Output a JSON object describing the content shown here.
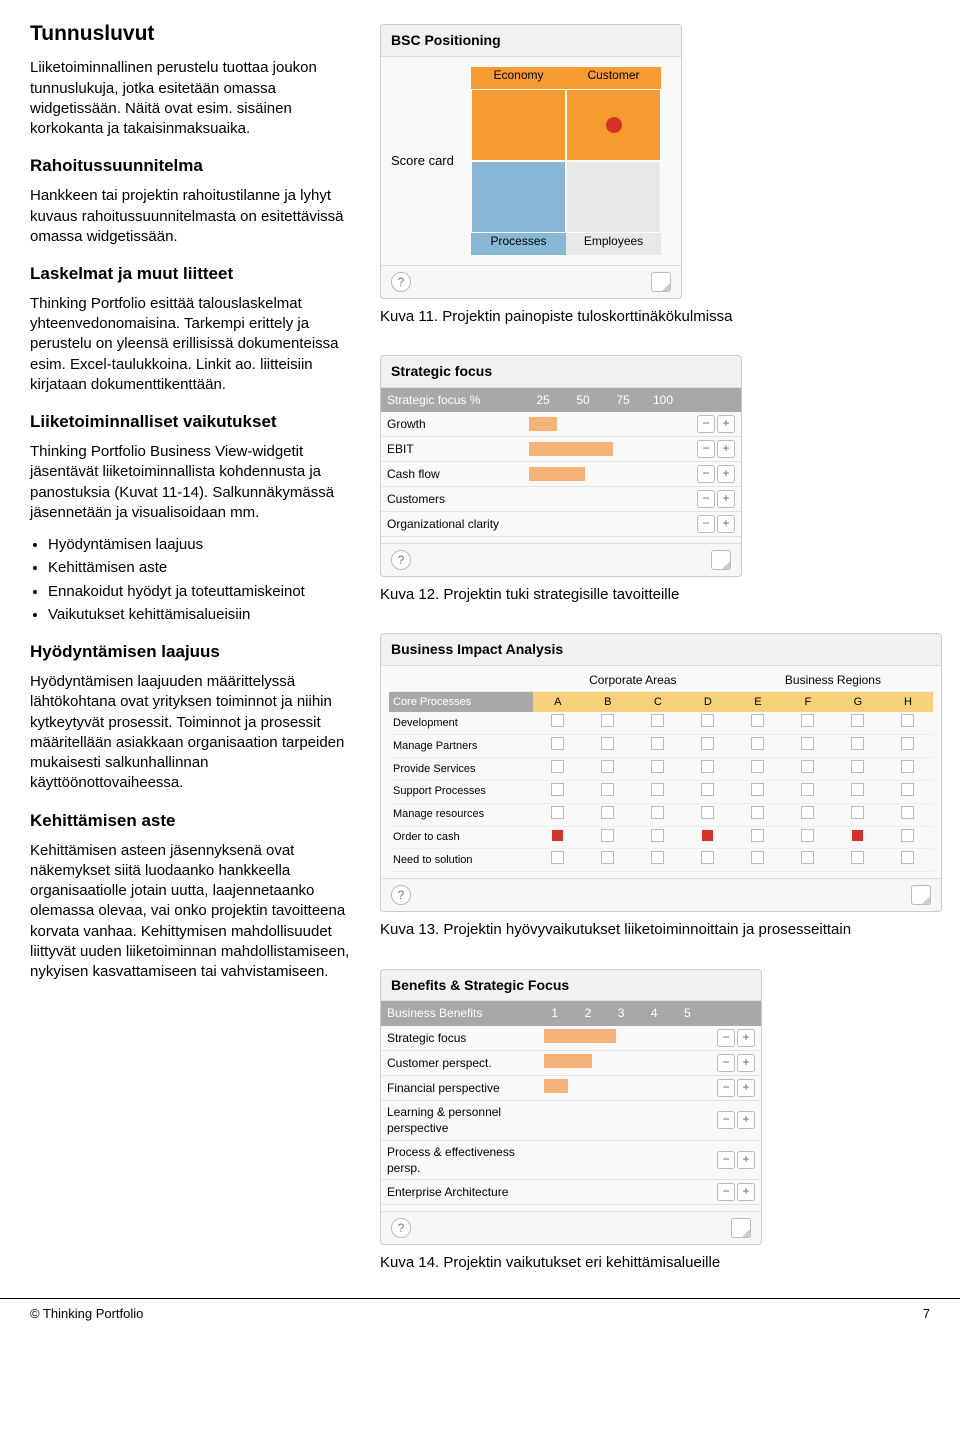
{
  "left": {
    "h1": "Tunnusluvut",
    "p1": "Liiketoiminnallinen perustelu tuottaa joukon tunnuslukuja, jotka esitetään omassa widgetissään. Näitä ovat esim. sisäinen korkokanta ja takaisin­maksuaika.",
    "h2a": "Rahoitussuunnitelma",
    "p2": "Hankkeen tai projektin rahoitustilanne ja lyhyt kuvaus rahoitussuunnitelmasta on esitettävissä omassa widgetissään.",
    "h2b": "Laskelmat ja muut liitteet",
    "p3": "Thinking Portfolio esittää talouslaskelmat yhteenvedonomaisina. Tarkempi erittely ja perustelu on yleensä erillisissä dokumenteissa esim. Excel-taulukkoina. Linkit ao. liitteisiin kirjataan dokumenttikenttään.",
    "h2c": "Liiketoiminnalliset vaikutukset",
    "p4": "Thinking Portfolio Business View-widgetit jäsentävät liiketoiminnallista kohdennusta ja panostuksia (Kuvat 11-14). Salkunnäkymässä jäsennetään ja visualisoidaan mm.",
    "bullets": [
      "Hyödyntämisen laajuus",
      "Kehittämisen aste",
      "Ennakoidut hyödyt ja toteuttamiskeinot",
      "Vaikutukset kehittämisalueisiin"
    ],
    "h2d": "Hyödyntämisen laajuus",
    "p5": "Hyödyntämisen laajuuden määrittelyssä lähtökohtana ovat yrityksen toiminnot ja niihin kytkeytyvät prosessit. Toiminnot ja prosessit määritellään asiakkaan organisaation tarpeiden mukaisesti salkunhallinnan käyttöönottovaiheessa.",
    "h2e": "Kehittämisen aste",
    "p6": "Kehittämisen asteen jäsennyksenä ovat näkemykset siitä luodaanko hankkeella organisaatiolle jotain uutta, laajennetaanko olemassa olevaa, vai onko projektin tavoitteena korvata vanhaa. Kehittymisen mahdollisuudet liittyvät uuden liiketoiminnan mahdollistamiseen, nykyisen kasvattamiseen tai vahvistamiseen."
  },
  "bsc": {
    "title": "BSC Positioning",
    "ylabel": "Score card",
    "top_left": "Economy",
    "top_right": "Customer",
    "bottom_left": "Processes",
    "bottom_right": "Employees"
  },
  "cap11": "Kuva 11. Projektin painopiste tuloskorttinäkökulmissa",
  "sf": {
    "title": "Strategic focus",
    "header": "Strategic focus %",
    "ticks": [
      "25",
      "50",
      "75",
      "100"
    ],
    "rows": [
      {
        "label": "Growth",
        "val": 1
      },
      {
        "label": "EBIT",
        "val": 3
      },
      {
        "label": "Cash flow",
        "val": 2
      },
      {
        "label": "Customers",
        "val": 0
      },
      {
        "label": "Organizational clarity",
        "val": 0
      }
    ]
  },
  "cap12": "Kuva 12. Projektin tuki strategisille tavoitteille",
  "bia": {
    "title": "Business Impact Analysis",
    "group1": "Corporate Areas",
    "group2": "Business Regions",
    "rowhead": "Core Processes",
    "cols": [
      "A",
      "B",
      "C",
      "D",
      "E",
      "F",
      "G",
      "H"
    ],
    "rows": [
      {
        "label": "Development",
        "cells": [
          0,
          0,
          0,
          0,
          0,
          0,
          0,
          0
        ]
      },
      {
        "label": "Manage Partners",
        "cells": [
          0,
          0,
          0,
          0,
          0,
          0,
          0,
          0
        ]
      },
      {
        "label": "Provide Services",
        "cells": [
          0,
          0,
          0,
          0,
          0,
          0,
          0,
          0
        ]
      },
      {
        "label": "Support Processes",
        "cells": [
          0,
          0,
          0,
          0,
          0,
          0,
          0,
          0
        ]
      },
      {
        "label": "Manage resources",
        "cells": [
          0,
          0,
          0,
          0,
          0,
          0,
          0,
          0
        ]
      },
      {
        "label": "Order to cash",
        "cells": [
          1,
          0,
          0,
          1,
          0,
          0,
          1,
          0
        ]
      },
      {
        "label": "Need to solution",
        "cells": [
          0,
          0,
          0,
          0,
          0,
          0,
          0,
          0
        ]
      }
    ]
  },
  "cap13": "Kuva 13. Projektin hyövyvaikutukset liiketoiminnoittain ja prosesseittain",
  "bb": {
    "title": "Benefits & Strategic Focus",
    "header": "Business Benefits",
    "ticks": [
      "1",
      "2",
      "3",
      "4",
      "5"
    ],
    "rows": [
      {
        "label": "Strategic focus",
        "val": 3
      },
      {
        "label": "Customer perspect.",
        "val": 2
      },
      {
        "label": "Financial perspective",
        "val": 1
      },
      {
        "label": "Learning & personnel perspective",
        "val": 0
      },
      {
        "label": "Process & effectiveness persp.",
        "val": 0
      },
      {
        "label": "Enterprise Architecture",
        "val": 0
      }
    ]
  },
  "cap14": "Kuva 14. Projektin vaikutukset eri kehittämisalueille",
  "footer_left": "© Thinking Portfolio",
  "footer_right": "7",
  "chart_data": [
    {
      "type": "heatmap",
      "title": "BSC Positioning",
      "x": [
        "Economy",
        "Customer"
      ],
      "y": [
        "Score card upper",
        "Score card lower"
      ],
      "highlight_cell": {
        "row": 0,
        "col": 1
      },
      "color_quadrants": {
        "top_left": "orange",
        "top_right": "orange",
        "bottom_left": "blue",
        "bottom_right": "grey"
      }
    },
    {
      "type": "bar",
      "title": "Strategic focus %",
      "categories": [
        "Growth",
        "EBIT",
        "Cash flow",
        "Customers",
        "Organizational clarity"
      ],
      "values": [
        25,
        75,
        50,
        0,
        0
      ],
      "xlabel": "",
      "ylabel": "",
      "ylim": [
        0,
        100
      ]
    },
    {
      "type": "heatmap",
      "title": "Business Impact Analysis",
      "x": [
        "A",
        "B",
        "C",
        "D",
        "E",
        "F",
        "G",
        "H"
      ],
      "y": [
        "Development",
        "Manage Partners",
        "Provide Services",
        "Support Processes",
        "Manage resources",
        "Order to cash",
        "Need to solution"
      ],
      "values": [
        [
          0,
          0,
          0,
          0,
          0,
          0,
          0,
          0
        ],
        [
          0,
          0,
          0,
          0,
          0,
          0,
          0,
          0
        ],
        [
          0,
          0,
          0,
          0,
          0,
          0,
          0,
          0
        ],
        [
          0,
          0,
          0,
          0,
          0,
          0,
          0,
          0
        ],
        [
          0,
          0,
          0,
          0,
          0,
          0,
          0,
          0
        ],
        [
          1,
          0,
          0,
          1,
          0,
          0,
          1,
          0
        ],
        [
          0,
          0,
          0,
          0,
          0,
          0,
          0,
          0
        ]
      ]
    },
    {
      "type": "bar",
      "title": "Business Benefits",
      "categories": [
        "Strategic focus",
        "Customer perspect.",
        "Financial perspective",
        "Learning & personnel perspective",
        "Process & effectiveness persp.",
        "Enterprise Architecture"
      ],
      "values": [
        3,
        2,
        1,
        0,
        0,
        0
      ],
      "xlabel": "",
      "ylabel": "",
      "ylim": [
        0,
        5
      ]
    }
  ]
}
